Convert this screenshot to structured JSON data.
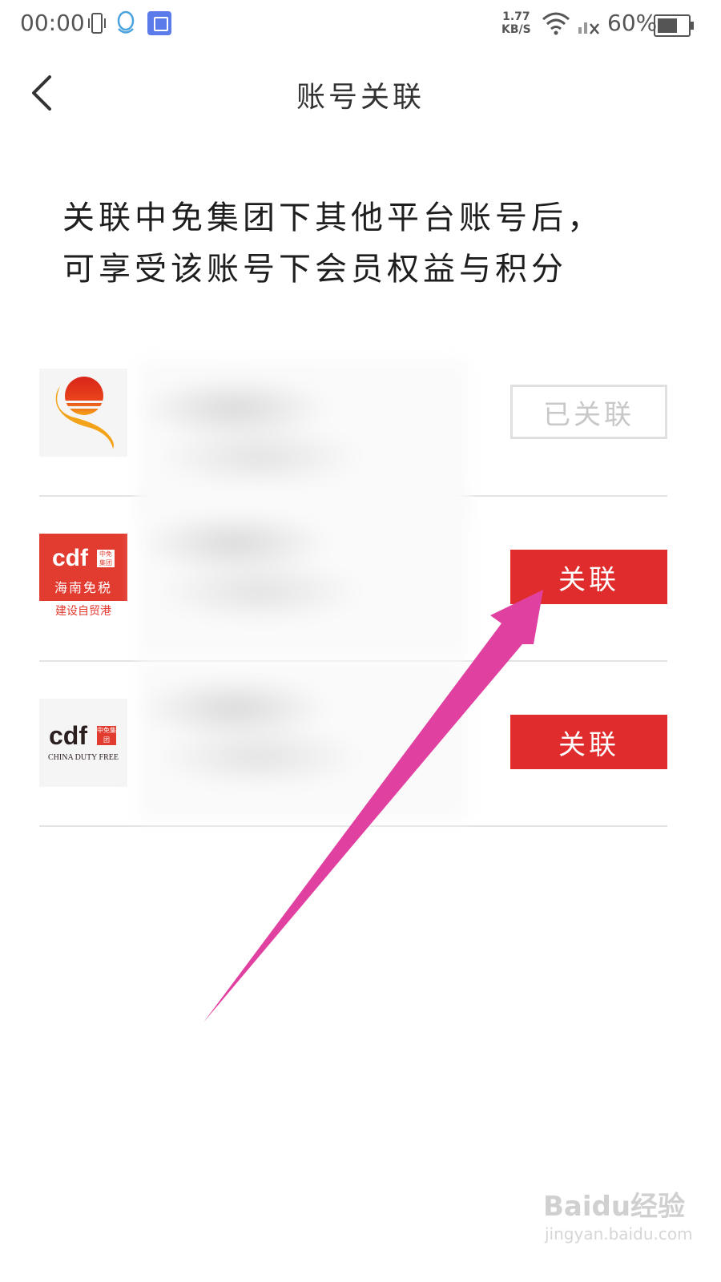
{
  "status_bar": {
    "time": "00:00",
    "net_speed_value": "1.77",
    "net_speed_unit": "KB/S",
    "battery": "60%",
    "icons": [
      "vibrate-icon",
      "qq-icon",
      "app-notification-icon",
      "wifi-icon",
      "signal-icon",
      "battery-icon"
    ]
  },
  "header": {
    "title": "账号关联",
    "back_icon": "chevron-left-icon"
  },
  "intro": {
    "line1": "关联中免集团下其他平台账号后，",
    "line2": "可享受该账号下会员权益与积分"
  },
  "accounts": [
    {
      "logo": "sun-swoosh-logo",
      "button_label": "已关联",
      "linked": true
    },
    {
      "logo": "cdf-hainan-logo",
      "logo_text": "cdf",
      "logo_sub": "海南免税",
      "logo_caption": "建设自贸港",
      "logo_badge": "中免集团",
      "button_label": "关联",
      "linked": false
    },
    {
      "logo": "cdf-china-duty-free-logo",
      "logo_text": "cdf",
      "logo_caption": "CHINA DUTY FREE",
      "logo_badge": "中免集团",
      "button_label": "关联",
      "linked": false
    }
  ],
  "annotation": {
    "arrow_color": "#e040a0"
  },
  "watermark": {
    "text": "Baidu经验",
    "sub": "jingyan.baidu.com"
  },
  "colors": {
    "accent": "#e02c2c",
    "disabled": "#c8c8c8"
  }
}
